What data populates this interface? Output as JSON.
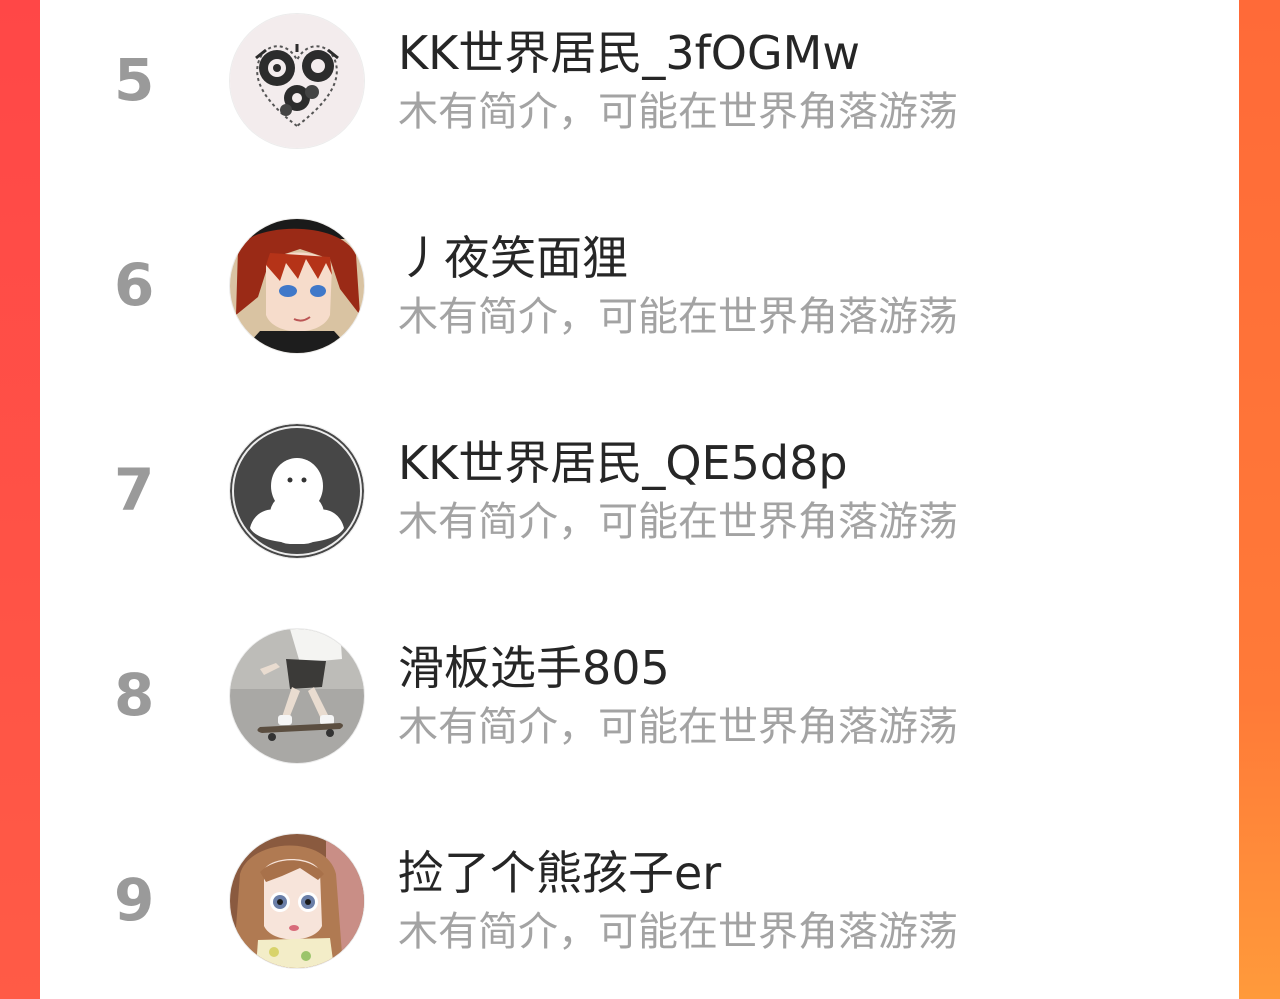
{
  "colors": {
    "accent_left": "#ff4747",
    "accent_right": "#ff7a38",
    "rank_color": "#9a9a9a",
    "name_color": "#262626",
    "bio_color": "#a3a3a3"
  },
  "ranking_list": {
    "items": [
      {
        "rank": "5",
        "name": "KK世界居民_3fOGMw",
        "bio": "木有简介，可能在世界角落游荡",
        "avatar_icon": "steampunk-heart-avatar"
      },
      {
        "rank": "6",
        "name": "丿夜笑面狸",
        "bio": "木有简介，可能在世界角落游荡",
        "avatar_icon": "anime-red-hair-avatar"
      },
      {
        "rank": "7",
        "name": "KK世界居民_QE5d8p",
        "bio": "木有简介，可能在世界角落游荡",
        "avatar_icon": "default-ghost-avatar"
      },
      {
        "rank": "8",
        "name": "滑板选手805",
        "bio": "木有简介，可能在世界角落游荡",
        "avatar_icon": "skateboard-avatar"
      },
      {
        "rank": "9",
        "name": "捡了个熊孩子er",
        "bio": "木有简介，可能在世界角落游荡",
        "avatar_icon": "doll-avatar"
      }
    ]
  }
}
